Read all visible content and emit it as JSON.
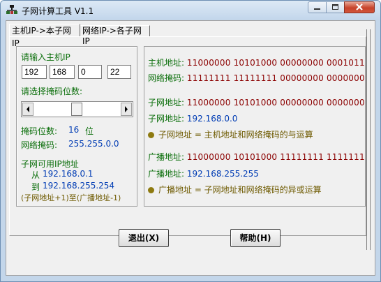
{
  "window": {
    "title": "子网计算工具 V1.1"
  },
  "tabs": [
    {
      "label": "主机IP->本子网IP",
      "selected": true
    },
    {
      "label": "网络IP->各子网IP",
      "selected": false
    }
  ],
  "host_ip": {
    "label": "请输入主机IP",
    "octets": [
      "192",
      "168",
      "0",
      "22"
    ]
  },
  "mask_bits": {
    "label": "请选择掩码位数:",
    "slider_value": 16,
    "slider_min": 0,
    "slider_max": 32,
    "bits_label": "掩码位数:",
    "bits_value": "16",
    "bits_unit": "位",
    "mask_label": "网络掩码:",
    "mask_value": "255.255.0.0"
  },
  "usable_range": {
    "label": "子网可用IP地址",
    "from_label": "从",
    "from_value": "192.168.0.1",
    "to_label": "到",
    "to_value": "192.168.255.254",
    "note": "(子网地址+1)至(广播地址-1)"
  },
  "results": {
    "host_addr_label": "主机地址:",
    "host_addr_binary": "11000000  10101000  00000000  00010110",
    "mask_label": "网络掩码:",
    "mask_binary": "11111111  11111111  00000000  00000000",
    "subnet_addr_label": "子网地址:",
    "subnet_addr_binary": "11000000  10101000  00000000  00000000",
    "subnet_label": "子网地址:",
    "subnet_value": "192.168.0.0",
    "subnet_note": "子网地址 = 主机地址和网络掩码的与运算",
    "broadcast_binary_label": "广播地址:",
    "broadcast_binary": "11000000  10101000  11111111  11111111",
    "broadcast_label": "广播地址:",
    "broadcast_value": "192.168.255.255",
    "broadcast_note": "广播地址 = 子网地址和网络掩码的异或运算"
  },
  "buttons": {
    "exit": "退出(X)",
    "help": "帮助(H)"
  },
  "colors": {
    "label_green": "#0a6e0a",
    "value_blue": "#003cb4",
    "binary_red": "#8b0000",
    "note_olive": "#6e5a00"
  }
}
